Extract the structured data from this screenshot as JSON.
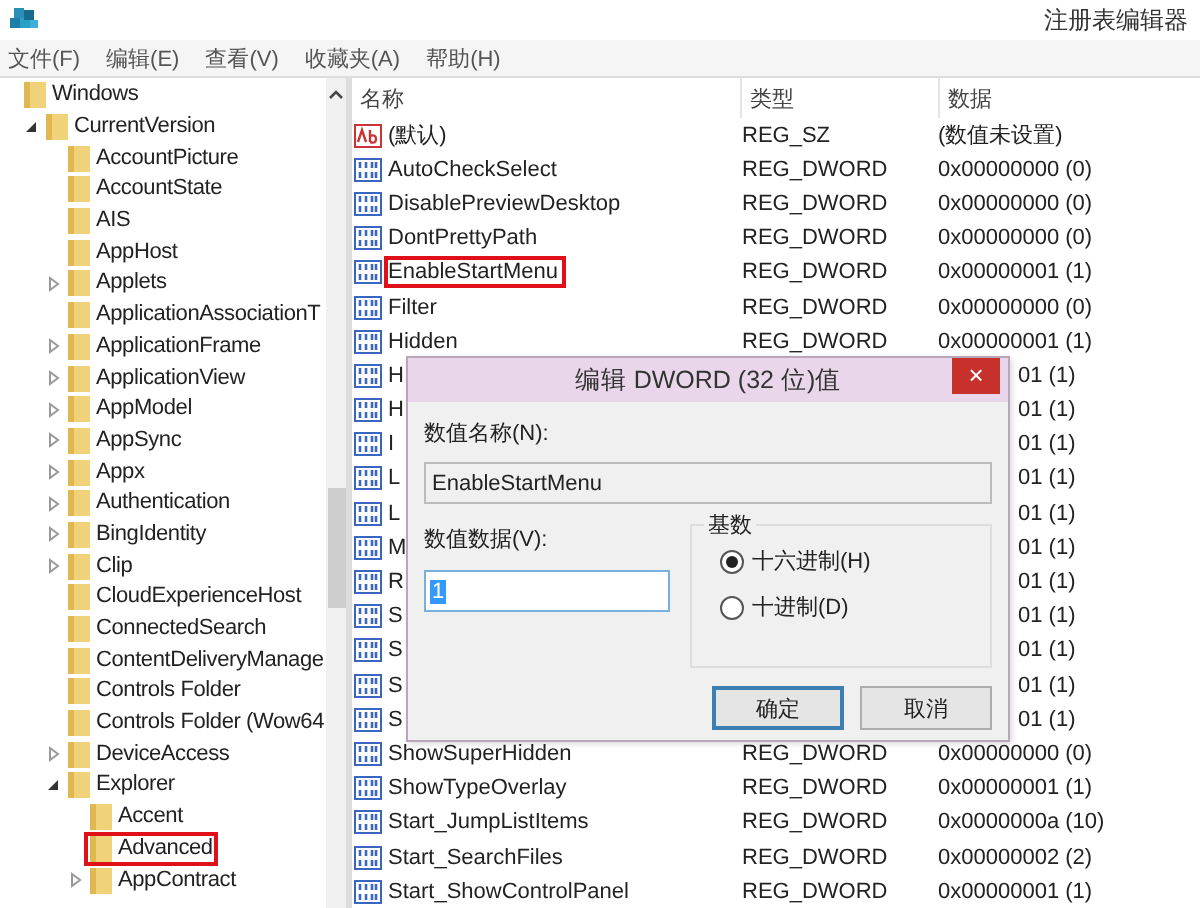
{
  "window": {
    "title": "注册表编辑器"
  },
  "menu": [
    "文件(F)",
    "编辑(E)",
    "查看(V)",
    "收藏夹(A)",
    "帮助(H)"
  ],
  "tree": [
    {
      "label": "Windows",
      "highlighted": false,
      "children": [
        {
          "label": "CurrentVersion",
          "expanded": true,
          "highlighted": false,
          "children": [
            {
              "label": "AccountPicture",
              "highlighted": false
            },
            {
              "label": "AccountState",
              "highlighted": false
            },
            {
              "label": "AIS",
              "highlighted": false
            },
            {
              "label": "AppHost",
              "highlighted": false
            },
            {
              "label": "Applets",
              "expanded": false,
              "highlighted": false
            },
            {
              "label": "ApplicationAssociationT",
              "highlighted": false
            },
            {
              "label": "ApplicationFrame",
              "expanded": false,
              "highlighted": false
            },
            {
              "label": "ApplicationView",
              "expanded": false,
              "highlighted": false
            },
            {
              "label": "AppModel",
              "expanded": false,
              "highlighted": false
            },
            {
              "label": "AppSync",
              "expanded": false,
              "highlighted": false
            },
            {
              "label": "Appx",
              "expanded": false,
              "highlighted": false
            },
            {
              "label": "Authentication",
              "expanded": false,
              "highlighted": false
            },
            {
              "label": "BingIdentity",
              "expanded": false,
              "highlighted": false
            },
            {
              "label": "Clip",
              "expanded": false,
              "highlighted": false
            },
            {
              "label": "CloudExperienceHost",
              "highlighted": false
            },
            {
              "label": "ConnectedSearch",
              "highlighted": false
            },
            {
              "label": "ContentDeliveryManage",
              "highlighted": false
            },
            {
              "label": "Controls Folder",
              "highlighted": false
            },
            {
              "label": "Controls Folder (Wow64",
              "highlighted": false
            },
            {
              "label": "DeviceAccess",
              "expanded": false,
              "highlighted": false
            },
            {
              "label": "Explorer",
              "expanded": true,
              "highlighted": false,
              "children": [
                {
                  "label": "Accent",
                  "highlighted": false
                },
                {
                  "label": "Advanced",
                  "highlighted": true
                },
                {
                  "label": "AppContract",
                  "expanded": false,
                  "highlighted": false
                }
              ]
            }
          ]
        }
      ]
    }
  ],
  "columns": [
    "名称",
    "类型",
    "数据"
  ],
  "rows": [
    {
      "kind": "string",
      "name": "(默认)",
      "type": "REG_SZ",
      "data": "(数值未设置)",
      "highlighted": false
    },
    {
      "kind": "dword",
      "name": "AutoCheckSelect",
      "type": "REG_DWORD",
      "data": "0x00000000 (0)",
      "highlighted": false
    },
    {
      "kind": "dword",
      "name": "DisablePreviewDesktop",
      "type": "REG_DWORD",
      "data": "0x00000000 (0)",
      "highlighted": false
    },
    {
      "kind": "dword",
      "name": "DontPrettyPath",
      "type": "REG_DWORD",
      "data": "0x00000000 (0)",
      "highlighted": false
    },
    {
      "kind": "dword",
      "name": "EnableStartMenu",
      "type": "REG_DWORD",
      "data": "0x00000001 (1)",
      "highlighted": true
    },
    {
      "kind": "dword",
      "name": "Filter",
      "type": "REG_DWORD",
      "data": "0x00000000 (0)",
      "highlighted": false
    },
    {
      "kind": "dword",
      "name": "Hidden",
      "type": "REG_DWORD",
      "data": "0x00000001 (1)",
      "highlighted": false
    },
    {
      "kind": "dword",
      "name": "H",
      "data": "01 (1)",
      "highlighted": false
    },
    {
      "kind": "dword",
      "name": "H",
      "data": "01 (1)",
      "highlighted": false
    },
    {
      "kind": "dword",
      "name": "I",
      "data": "01 (1)",
      "highlighted": false
    },
    {
      "kind": "dword",
      "name": "L",
      "data": "01 (1)",
      "highlighted": false
    },
    {
      "kind": "dword",
      "name": "L",
      "data": "01 (1)",
      "highlighted": false
    },
    {
      "kind": "dword",
      "name": "M",
      "data": "01 (1)",
      "highlighted": false
    },
    {
      "kind": "dword",
      "name": "R",
      "data": "01 (1)",
      "highlighted": false
    },
    {
      "kind": "dword",
      "name": "S",
      "data": "01 (1)",
      "highlighted": false
    },
    {
      "kind": "dword",
      "name": "S",
      "data": "01 (1)",
      "highlighted": false
    },
    {
      "kind": "dword",
      "name": "S",
      "data": "01 (1)",
      "highlighted": false
    },
    {
      "kind": "dword",
      "name": "S",
      "data": "01 (1)",
      "highlighted": false
    },
    {
      "kind": "dword",
      "name": "ShowSuperHidden",
      "type": "REG_DWORD",
      "data": "0x00000000 (0)",
      "highlighted": false
    },
    {
      "kind": "dword",
      "name": "ShowTypeOverlay",
      "type": "REG_DWORD",
      "data": "0x00000001 (1)",
      "highlighted": false
    },
    {
      "kind": "dword",
      "name": "Start_JumpListItems",
      "type": "REG_DWORD",
      "data": "0x0000000a (10)",
      "highlighted": false
    },
    {
      "kind": "dword",
      "name": "Start_SearchFiles",
      "type": "REG_DWORD",
      "data": "0x00000002 (2)",
      "highlighted": false
    },
    {
      "kind": "dword",
      "name": "Start_ShowControlPanel",
      "type": "REG_DWORD",
      "data": "0x00000001 (1)",
      "highlighted": false
    }
  ],
  "dialog": {
    "title": "编辑 DWORD (32 位)值",
    "close": "×",
    "name_label": "数值名称(N):",
    "name_value": "EnableStartMenu",
    "data_label": "数值数据(V):",
    "data_value": "1",
    "base_label": "基数",
    "bases": [
      {
        "label": "十六进制(H)",
        "selected": true
      },
      {
        "label": "十进制(D)",
        "selected": false
      }
    ],
    "buttons": [
      {
        "label": "确定",
        "default": true
      },
      {
        "label": "取消",
        "default": false
      }
    ]
  }
}
